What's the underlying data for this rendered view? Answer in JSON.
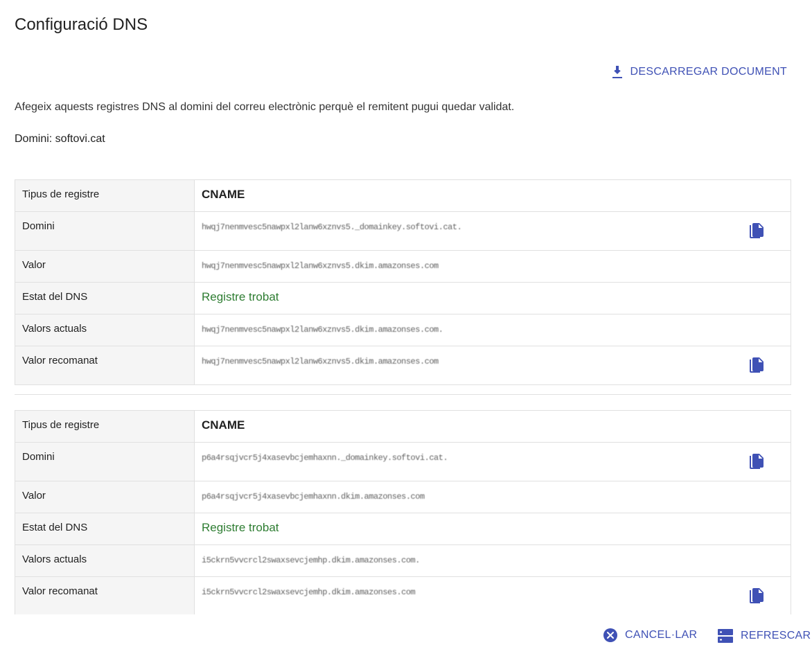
{
  "header": {
    "title": "Configuració DNS",
    "download_label": "DESCARREGAR DOCUMENT"
  },
  "intro": "Afegeix aquests registres DNS al domini del correu electrònic perquè el remitent pugui quedar validat.",
  "domain_line": "Domini: softovi.cat",
  "labels": {
    "type": "Tipus de registre",
    "domain": "Domini",
    "value": "Valor",
    "status": "Estat del DNS",
    "current": "Valors actuals",
    "recommended": "Valor recomanat"
  },
  "records": [
    {
      "type": "CNAME",
      "domain": "hwqj7nenmvesc5nawpxl2lanw6xznvs5._domainkey.softovi.cat.",
      "value": "hwqj7nenmvesc5nawpxl2lanw6xznvs5.dkim.amazonses.com",
      "status": "Registre trobat",
      "current": "hwqj7nenmvesc5nawpxl2lanw6xznvs5.dkim.amazonses.com.",
      "recommended": "hwqj7nenmvesc5nawpxl2lanw6xznvs5.dkim.amazonses.com"
    },
    {
      "type": "CNAME",
      "domain": "p6a4rsqjvcr5j4xasevbcjemhaxnn._domainkey.softovi.cat.",
      "value": "p6a4rsqjvcr5j4xasevbcjemhaxnn.dkim.amazonses.com",
      "status": "Registre trobat",
      "current": "i5ckrn5vvcrcl2swaxsevcjemhp.dkim.amazonses.com.",
      "recommended": "i5ckrn5vvcrcl2swaxsevcjemhp.dkim.amazonses.com"
    }
  ],
  "footer": {
    "cancel_label": "CANCEL·LAR",
    "refresh_label": "REFRESCAR"
  },
  "colors": {
    "accent": "#3f51b5",
    "success": "#2e7d32",
    "label_bg": "#f5f5f5",
    "border": "#e0e0e0"
  }
}
